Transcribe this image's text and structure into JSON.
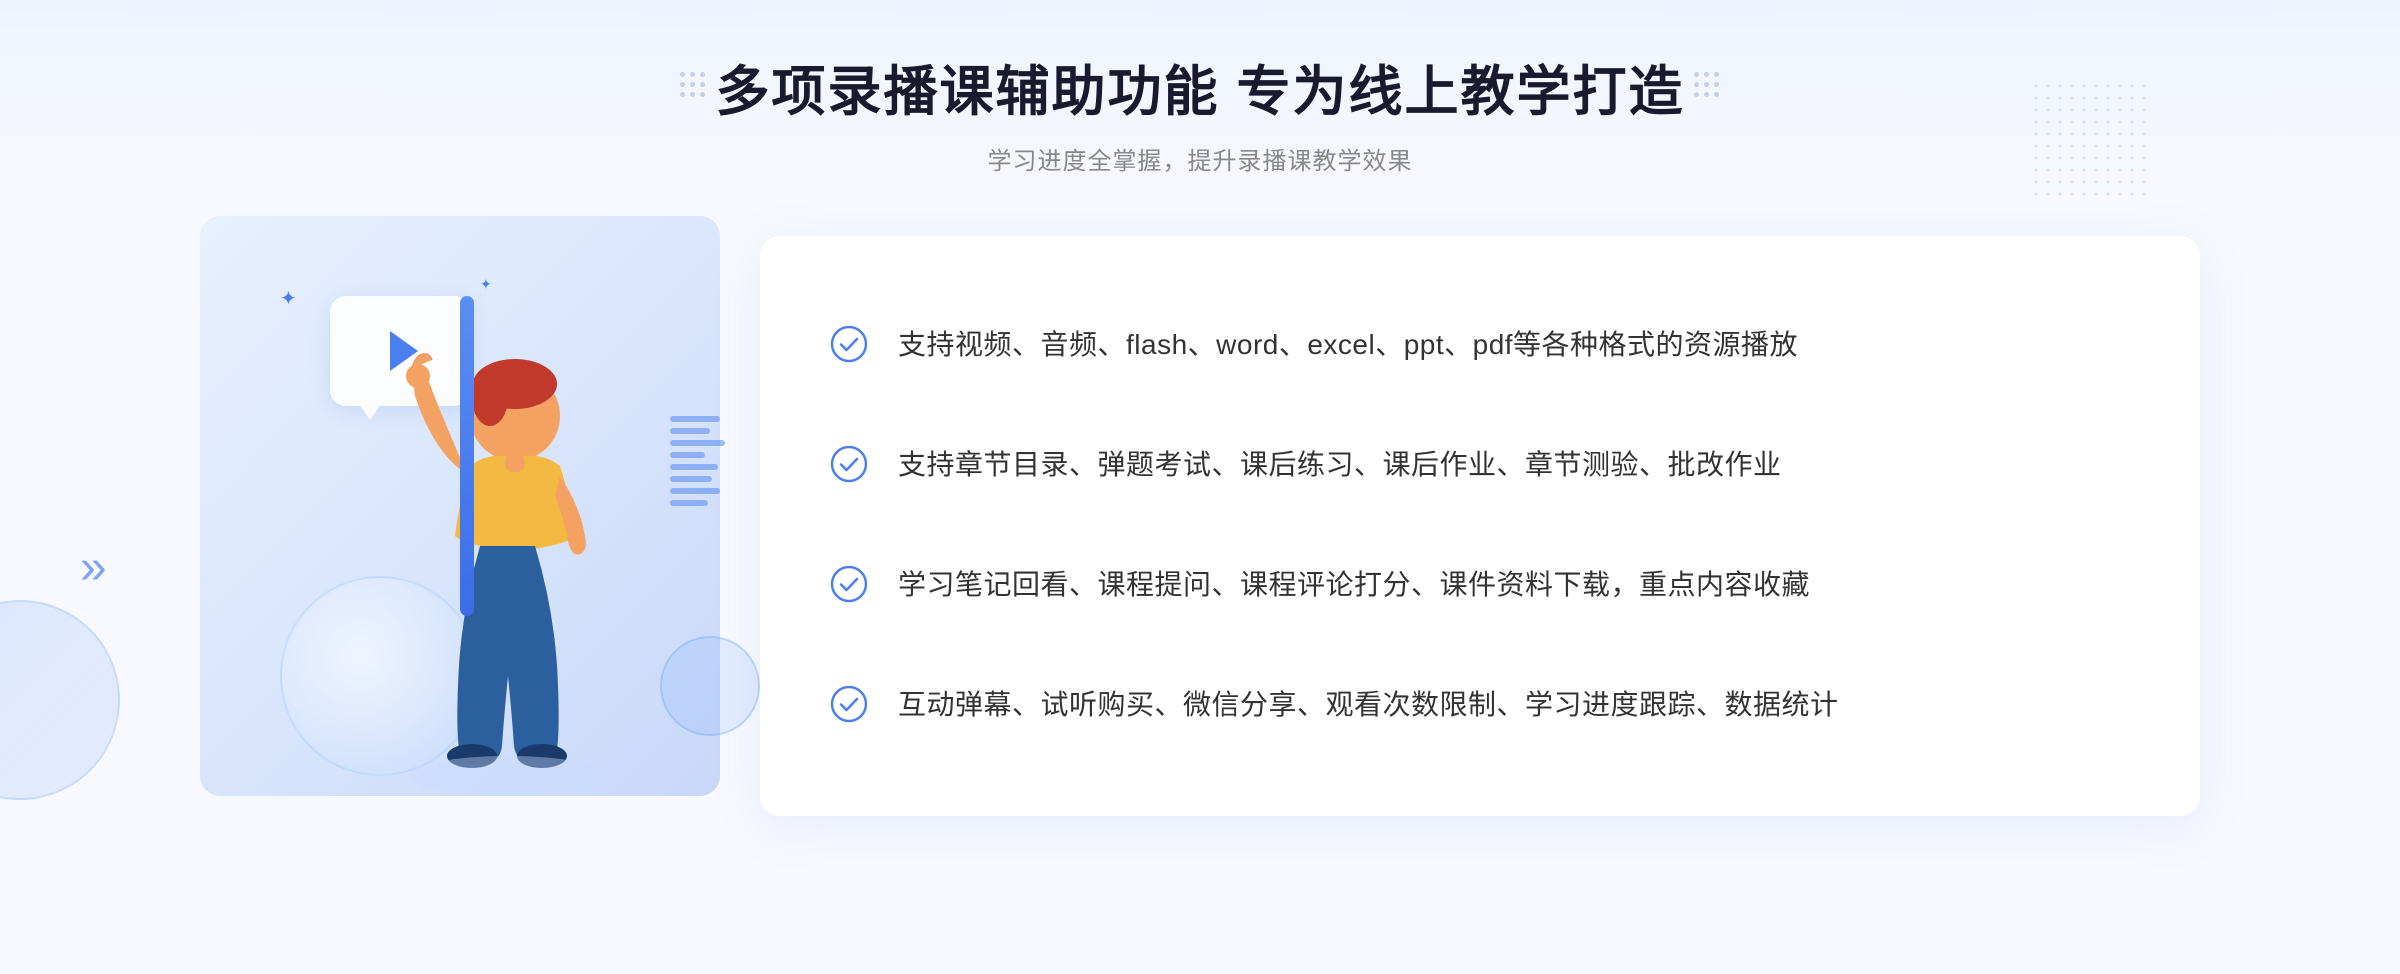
{
  "header": {
    "title": "多项录播课辅助功能 专为线上教学打造",
    "subtitle": "学习进度全掌握，提升录播课教学效果"
  },
  "features": [
    {
      "id": 1,
      "text": "支持视频、音频、flash、word、excel、ppt、pdf等各种格式的资源播放"
    },
    {
      "id": 2,
      "text": "支持章节目录、弹题考试、课后练习、课后作业、章节测验、批改作业"
    },
    {
      "id": 3,
      "text": "学习笔记回看、课程提问、课程评论打分、课件资料下载，重点内容收藏"
    },
    {
      "id": 4,
      "text": "互动弹幕、试听购买、微信分享、观看次数限制、学习进度跟踪、数据统计"
    }
  ],
  "colors": {
    "accent_blue": "#4a7ff0",
    "title_dark": "#1a1a2e",
    "text_gray": "#333333",
    "subtitle_gray": "#888888",
    "check_blue": "#4a7ff0",
    "bg_light": "#f8f9ff"
  },
  "icons": {
    "check": "checkmark-circle-icon",
    "play": "play-icon",
    "chevron_left": "chevron-left-icon"
  }
}
